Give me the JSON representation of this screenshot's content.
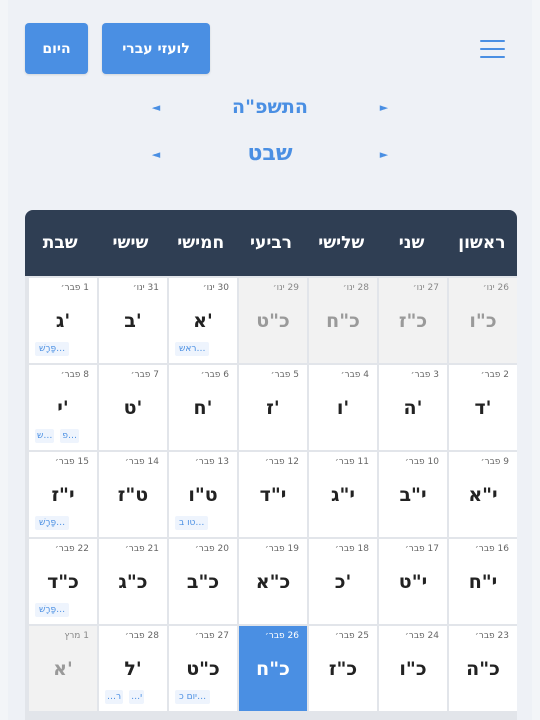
{
  "toolbar": {
    "today_label": "היום",
    "greg_label": "לועזי עברי"
  },
  "nav": {
    "year": "התשפ\"ה",
    "month": "שבט",
    "prev_symbol": "◄",
    "next_symbol": "►"
  },
  "weekdays": [
    "ראשון",
    "שני",
    "שלישי",
    "רביעי",
    "חמישי",
    "שישי",
    "שבת"
  ],
  "weeks": [
    [
      {
        "heb": "כ\"ו",
        "greg": "26 ינו׳",
        "other": true
      },
      {
        "heb": "כ\"ז",
        "greg": "27 ינו׳",
        "other": true
      },
      {
        "heb": "כ\"ח",
        "greg": "28 ינו׳",
        "other": true
      },
      {
        "heb": "כ\"ט",
        "greg": "29 ינו׳",
        "other": true
      },
      {
        "heb": "א'",
        "greg": "30 ינו׳",
        "events": [
          "ראש…"
        ]
      },
      {
        "heb": "ב'",
        "greg": "31 ינו׳"
      },
      {
        "heb": "ג'",
        "greg": "1 פבר׳",
        "events": [
          "פָּרָשׁ…"
        ]
      }
    ],
    [
      {
        "heb": "ד'",
        "greg": "2 פבר׳"
      },
      {
        "heb": "ה'",
        "greg": "3 פבר׳"
      },
      {
        "heb": "ו'",
        "greg": "4 פבר׳"
      },
      {
        "heb": "ז'",
        "greg": "5 פבר׳"
      },
      {
        "heb": "ח'",
        "greg": "6 פבר׳"
      },
      {
        "heb": "ט'",
        "greg": "7 פבר׳"
      },
      {
        "heb": "י'",
        "greg": "8 פבר׳",
        "events": [
          "ש…",
          "פ…"
        ]
      }
    ],
    [
      {
        "heb": "י\"א",
        "greg": "9 פבר׳"
      },
      {
        "heb": "י\"ב",
        "greg": "10 פבר׳"
      },
      {
        "heb": "י\"ג",
        "greg": "11 פבר׳"
      },
      {
        "heb": "י\"ד",
        "greg": "12 פבר׳"
      },
      {
        "heb": "ט\"ו",
        "greg": "13 פבר׳",
        "events": [
          "טו ב…"
        ]
      },
      {
        "heb": "ט\"ז",
        "greg": "14 פבר׳"
      },
      {
        "heb": "י\"ז",
        "greg": "15 פבר׳",
        "events": [
          "פָּרָשׁ…"
        ]
      }
    ],
    [
      {
        "heb": "י\"ח",
        "greg": "16 פבר׳"
      },
      {
        "heb": "י\"ט",
        "greg": "17 פבר׳"
      },
      {
        "heb": "כ'",
        "greg": "18 פבר׳"
      },
      {
        "heb": "כ\"א",
        "greg": "19 פבר׳"
      },
      {
        "heb": "כ\"ב",
        "greg": "20 פבר׳"
      },
      {
        "heb": "כ\"ג",
        "greg": "21 פבר׳"
      },
      {
        "heb": "כ\"ד",
        "greg": "22 פבר׳",
        "events": [
          "פָּרָשׁ…"
        ]
      }
    ],
    [
      {
        "heb": "כ\"ה",
        "greg": "23 פבר׳"
      },
      {
        "heb": "כ\"ו",
        "greg": "24 פבר׳"
      },
      {
        "heb": "כ\"ז",
        "greg": "25 פבר׳"
      },
      {
        "heb": "כ\"ח",
        "greg": "26 פבר׳",
        "today": true
      },
      {
        "heb": "כ\"ט",
        "greg": "27 פבר׳",
        "events": [
          "יום כ…"
        ]
      },
      {
        "heb": "ל'",
        "greg": "28 פבר׳",
        "events": [
          "…ר",
          "…י"
        ]
      },
      {
        "heb": "א'",
        "greg": "1 מרץ",
        "other": true
      }
    ]
  ],
  "colors": {
    "accent": "#4a8fe3",
    "header_bg": "#2f3e53",
    "other_month_bg": "#f2f2f2"
  }
}
